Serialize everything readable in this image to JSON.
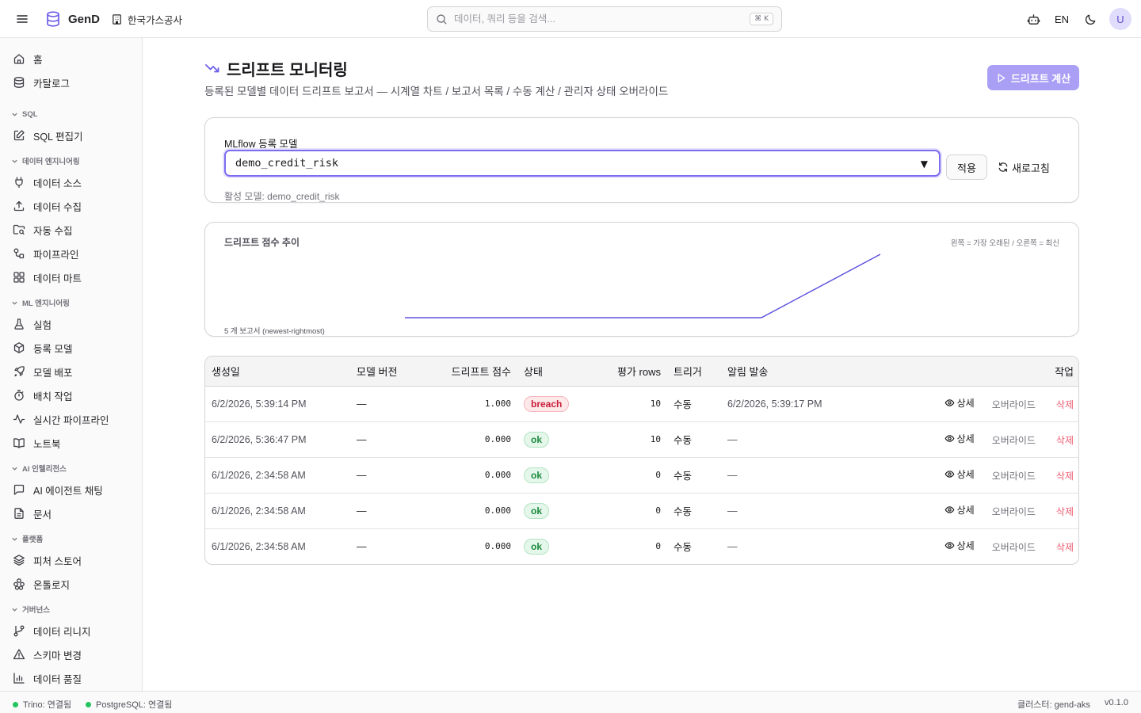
{
  "app": {
    "name": "GenD",
    "org": "한국가스공사"
  },
  "search": {
    "placeholder": "데이터, 쿼리 등을 검색...",
    "shortcut": "⌘ K"
  },
  "header": {
    "lang": "EN",
    "avatar": "U"
  },
  "sidebar": {
    "items": [
      {
        "label": "홈",
        "icon": "home-icon"
      },
      {
        "label": "카탈로그",
        "icon": "database-icon"
      }
    ],
    "sections": [
      {
        "title": "SQL",
        "items": [
          {
            "label": "SQL 편집기",
            "icon": "edit-icon"
          }
        ]
      },
      {
        "title": "데이터 엔지니어링",
        "items": [
          {
            "label": "데이터 소스",
            "icon": "plug-icon"
          },
          {
            "label": "데이터 수집",
            "icon": "upload-icon"
          },
          {
            "label": "자동 수집",
            "icon": "folder-search-icon"
          },
          {
            "label": "파이프라인",
            "icon": "workflow-icon"
          },
          {
            "label": "데이터 마트",
            "icon": "grid-icon"
          }
        ]
      },
      {
        "title": "ML 엔지니어링",
        "items": [
          {
            "label": "실험",
            "icon": "flask-icon"
          },
          {
            "label": "등록 모델",
            "icon": "box-icon"
          },
          {
            "label": "모델 배포",
            "icon": "rocket-icon"
          },
          {
            "label": "배치 작업",
            "icon": "timer-icon"
          },
          {
            "label": "실시간 파이프라인",
            "icon": "activity-icon"
          },
          {
            "label": "노트북",
            "icon": "book-icon"
          }
        ]
      },
      {
        "title": "AI 인텔리전스",
        "items": [
          {
            "label": "AI 에이전트 채팅",
            "icon": "chat-icon"
          },
          {
            "label": "문서",
            "icon": "file-icon"
          }
        ]
      },
      {
        "title": "플랫폼",
        "items": [
          {
            "label": "피처 스토어",
            "icon": "layers-icon"
          },
          {
            "label": "온톨로지",
            "icon": "ontology-icon"
          }
        ]
      },
      {
        "title": "거버넌스",
        "items": [
          {
            "label": "데이터 리니지",
            "icon": "branch-icon"
          },
          {
            "label": "스키마 변경",
            "icon": "warning-icon"
          },
          {
            "label": "데이터 품질",
            "icon": "bar-chart-icon"
          }
        ]
      }
    ]
  },
  "page": {
    "title": "드리프트 모니터링",
    "subtitle": "등록된 모델별 데이터 드리프트 보고서 — 시계열 차트 / 보고서 목록 / 수동 계산 / 관리자 상태 오버라이드",
    "compute_button": "드리프트 계산"
  },
  "model_select": {
    "label": "MLflow 등록 모델",
    "value": "demo_credit_risk",
    "apply": "적용",
    "refresh": "새로고침",
    "active_text": "활성 모델: demo_credit_risk"
  },
  "chart_card": {
    "title": "드리프트 점수 추이",
    "hint": "왼쪽 = 가장 오래된 / 오른쪽 = 최신",
    "footer": "5 개 보고서 (newest-rightmost)"
  },
  "chart_data": {
    "type": "line",
    "x": [
      1,
      2,
      3,
      4,
      5
    ],
    "series": [
      {
        "values": [
          0.0,
          0.0,
          0.0,
          0.0,
          1.0
        ]
      }
    ],
    "ylim": [
      0,
      1
    ],
    "grid": false,
    "line_color": "#5b4fe0"
  },
  "table": {
    "headers": [
      "생성일",
      "모델 버전",
      "드리프트 점수",
      "상태",
      "평가 rows",
      "트리거",
      "알림 발송",
      "작업"
    ],
    "actions": {
      "detail": "상세",
      "override": "오버라이드",
      "delete": "삭제"
    },
    "rows": [
      {
        "created": "6/2/2026, 5:39:14 PM",
        "version": "—",
        "score": "1.000",
        "status": "breach",
        "rows": "10",
        "trigger": "수동",
        "alert": "6/2/2026, 5:39:17 PM"
      },
      {
        "created": "6/2/2026, 5:36:47 PM",
        "version": "—",
        "score": "0.000",
        "status": "ok",
        "rows": "10",
        "trigger": "수동",
        "alert": "—"
      },
      {
        "created": "6/1/2026, 2:34:58 AM",
        "version": "—",
        "score": "0.000",
        "status": "ok",
        "rows": "0",
        "trigger": "수동",
        "alert": "—"
      },
      {
        "created": "6/1/2026, 2:34:58 AM",
        "version": "—",
        "score": "0.000",
        "status": "ok",
        "rows": "0",
        "trigger": "수동",
        "alert": "—"
      },
      {
        "created": "6/1/2026, 2:34:58 AM",
        "version": "—",
        "score": "0.000",
        "status": "ok",
        "rows": "0",
        "trigger": "수동",
        "alert": "—"
      }
    ]
  },
  "statusbar": {
    "trino": "Trino: 연결됨",
    "postgres": "PostgreSQL: 연결됨",
    "cluster": "클러스터: gend-aks",
    "version": "v0.1.0"
  },
  "colors": {
    "accent": "#7c6df0",
    "accent_light": "#a99ff5",
    "ok": "#22c55e",
    "breach": "#c81e3a"
  }
}
